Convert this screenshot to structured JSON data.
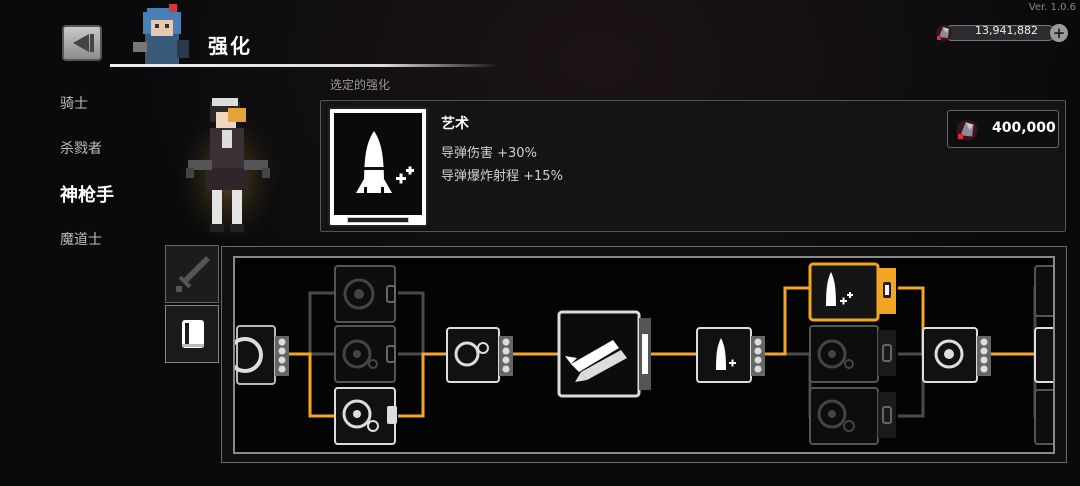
{
  "version": "Ver. 1.0.6",
  "header": {
    "title": "强化"
  },
  "currency": {
    "amount": "13,941,882",
    "icon": "gem-icon",
    "plus_label": "+"
  },
  "nav": {
    "items": [
      {
        "label": "骑士",
        "active": false
      },
      {
        "label": "杀戮者",
        "active": false
      },
      {
        "label": "神枪手",
        "active": true
      },
      {
        "label": "魔道士",
        "active": false
      }
    ]
  },
  "section_label": "选定的强化",
  "selected_skill": {
    "name": "艺术",
    "icon": "missile-plus-icon",
    "effects": [
      "导弹伤害 +30%",
      "导弹爆炸射程 +15%"
    ],
    "cost": "400,000"
  },
  "tabs": [
    {
      "icon": "sword-icon",
      "active": false
    },
    {
      "icon": "book-icon",
      "active": true
    }
  ],
  "colors": {
    "accent": "#f3a623",
    "panel_border": "#8a8a8a",
    "line_inactive": "#555555"
  }
}
